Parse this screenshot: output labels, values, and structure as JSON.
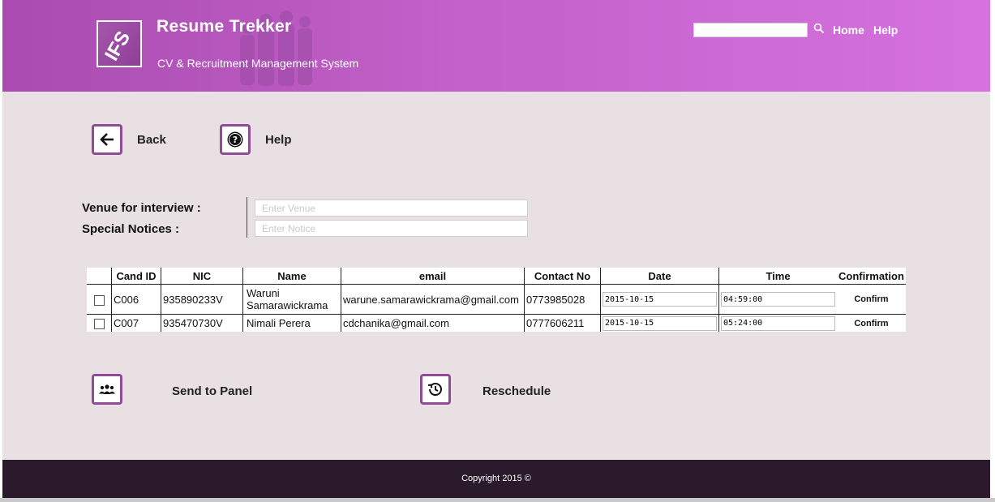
{
  "header": {
    "logo_text": "IFS",
    "app_title": "Resume Trekker",
    "app_subtitle": "CV & Recruitment Management System",
    "search_placeholder": "",
    "nav": {
      "home": "Home",
      "help": "Help"
    }
  },
  "actions": {
    "back": "Back",
    "help": "Help",
    "send_to_panel": "Send to Panel",
    "reschedule": "Reschedule"
  },
  "form": {
    "venue_label": "Venue for interview :",
    "venue_placeholder": "Enter Venue",
    "notice_label": "Special Notices :",
    "notice_placeholder": "Enter Notice"
  },
  "table": {
    "headers": [
      "",
      "Cand ID",
      "NIC",
      "Name",
      "email",
      "Contact No",
      "Date",
      "Time",
      "Confirmation"
    ],
    "rows": [
      {
        "cand_id": "C006",
        "nic": "935890233V",
        "name": "Waruni Samarawickrama",
        "email": "warune.samarawickrama@gmail.com",
        "contact": "0773985028",
        "date": "2015-10-15",
        "time": "04:59:00",
        "confirm": "Confirm"
      },
      {
        "cand_id": "C007",
        "nic": "935470730V",
        "name": "Nimali Perera",
        "email": "cdchanika@gmail.com",
        "contact": "0777606211",
        "date": "2015-10-15",
        "time": "05:24:00",
        "confirm": "Confirm"
      }
    ]
  },
  "footer": {
    "copyright": "Copyright 2015 ©"
  },
  "colors": {
    "header_start": "#a94bb0",
    "header_end": "#d671df",
    "accent": "#8f4b95",
    "page_bg": "#e8e0e2",
    "footer_bg": "#2a1a2c"
  },
  "icons": {
    "back": "arrow-left-icon",
    "help": "question-circle-icon",
    "send_to_panel": "group-icon",
    "reschedule": "history-icon",
    "search": "search-icon"
  }
}
